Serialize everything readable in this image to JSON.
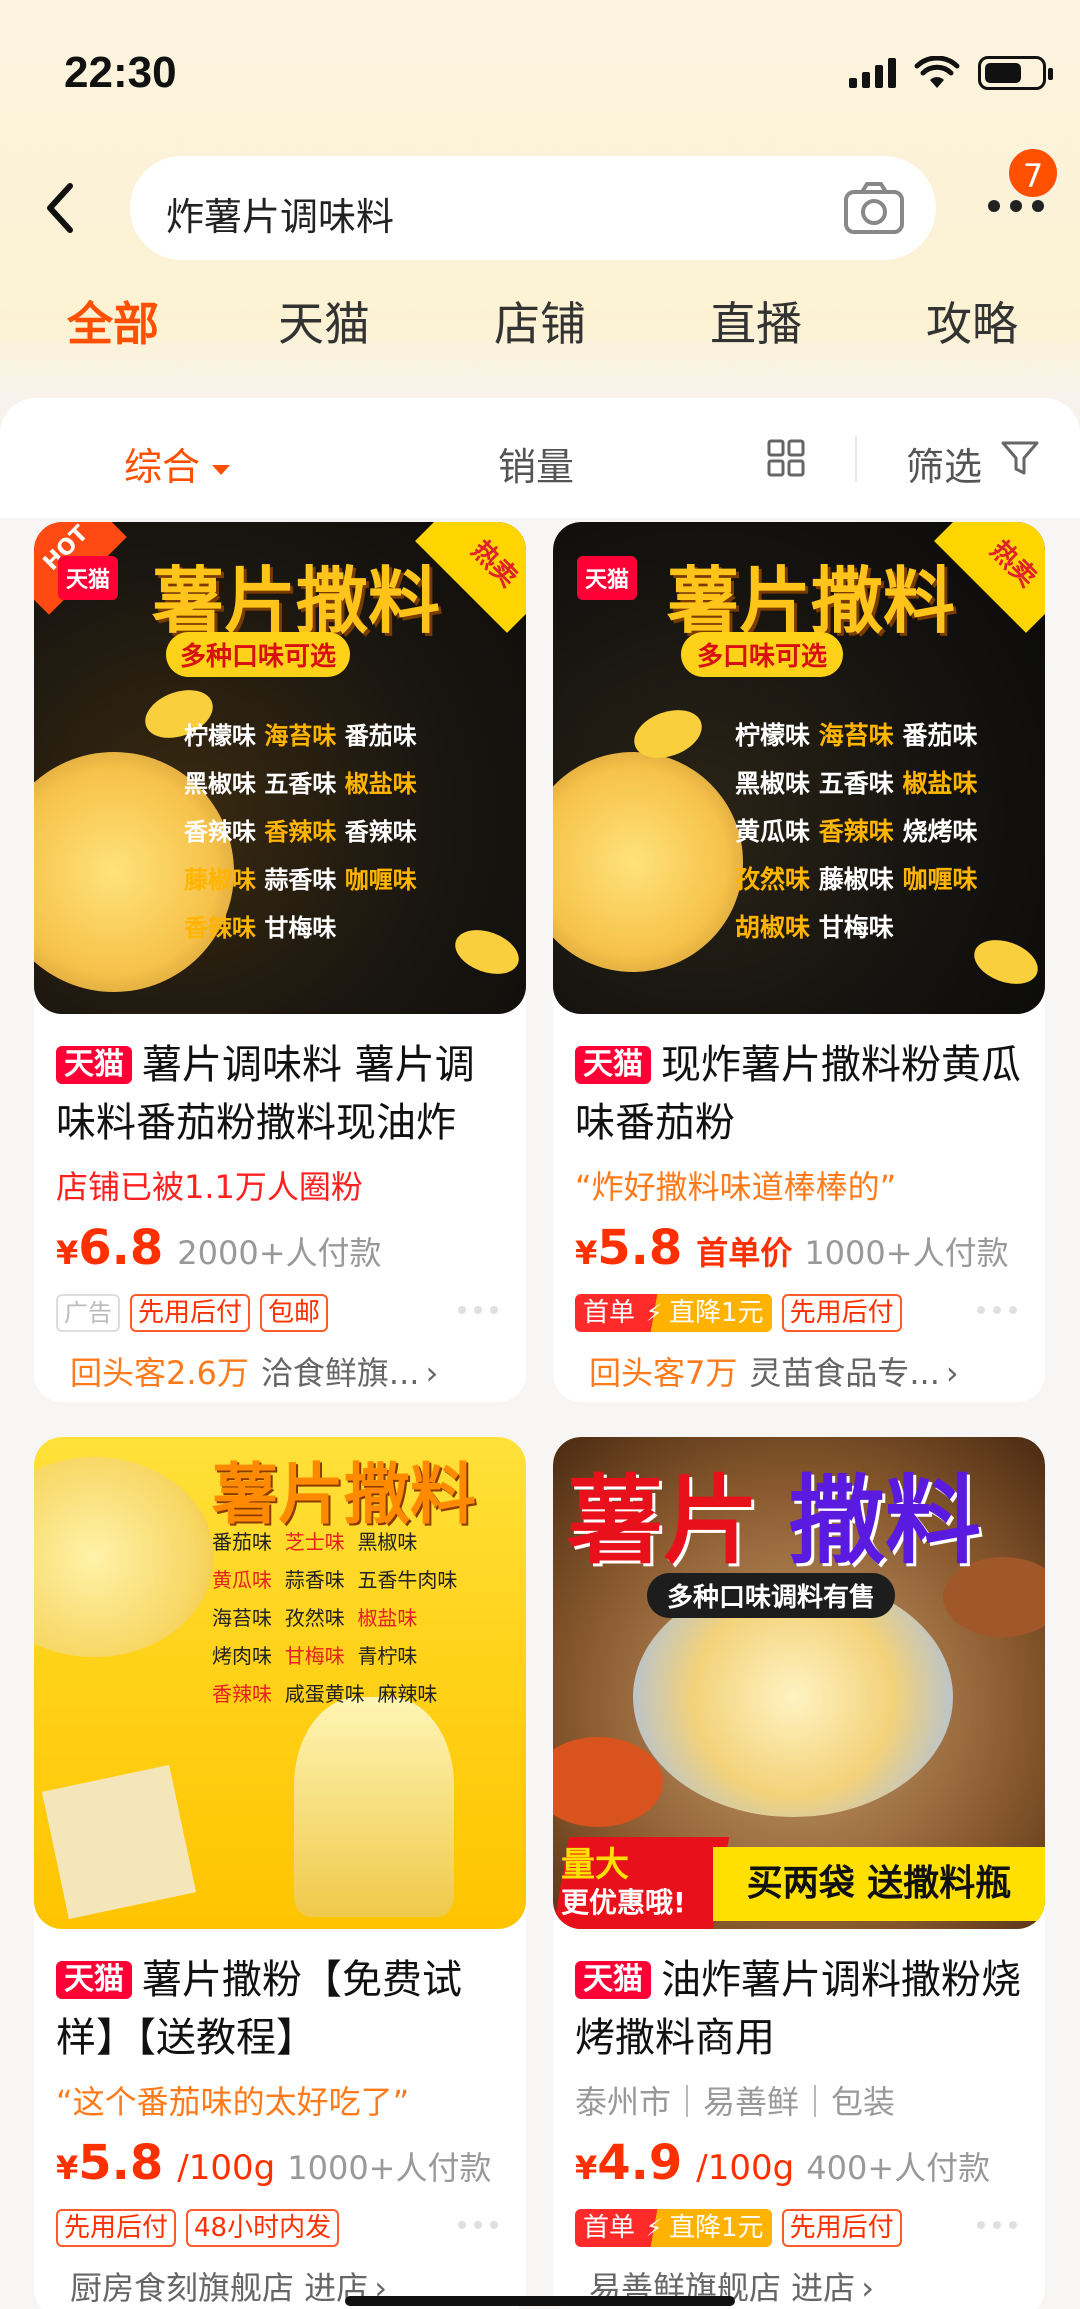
{
  "status": {
    "time": "22:30"
  },
  "search": {
    "query": "炸薯片调味料",
    "cart_badge": "7"
  },
  "tabs": [
    "全部",
    "天猫",
    "店铺",
    "直播",
    "攻略"
  ],
  "sort": {
    "comprehensive": "综合",
    "sales": "销量",
    "filter": "筛选"
  },
  "products": [
    {
      "tmall": "天猫",
      "title": "薯片调味料 薯片调味料番茄粉撒料现油炸",
      "subline": "店铺已被1.1万人圈粉",
      "yen": "¥",
      "price": "6.8",
      "paid": "2000+人付款",
      "tags": [
        "广告",
        "先用后付",
        "包邮"
      ],
      "returning": "回头客2.6万",
      "shop": "洽食鲜旗...",
      "poster": {
        "tmall": "天猫",
        "hot": "HOT",
        "hot_sale": "热卖",
        "headline": "薯片撒料",
        "badge": "多种口味可选",
        "flavors": [
          [
            "柠檬味",
            "海苔味",
            "番茄味"
          ],
          [
            "黑椒味",
            "五香味",
            "椒盐味"
          ],
          [
            "香辣味",
            "香辣味",
            "香辣味"
          ],
          [
            "藤椒味",
            "蒜香味",
            "咖喱味"
          ],
          [
            "香辣味",
            "甘梅味",
            ""
          ]
        ]
      }
    },
    {
      "tmall": "天猫",
      "title": "现炸薯片撒料粉黄瓜味番茄粉",
      "subline": "“炸好撒料味道棒棒的”",
      "yen": "¥",
      "price": "5.8",
      "first_price": "首单价",
      "paid": "1000+人付款",
      "first_tag": [
        "首单",
        "直降1元"
      ],
      "tags": [
        "先用后付"
      ],
      "returning": "回头客7万",
      "shop": "灵苗食品专...",
      "poster": {
        "tmall": "天猫",
        "hot_sale": "热卖",
        "headline": "薯片撒料",
        "badge": "多口味可选",
        "flavors": [
          [
            "柠檬味",
            "海苔味",
            "番茄味"
          ],
          [
            "黑椒味",
            "五香味",
            "椒盐味"
          ],
          [
            "黄瓜味",
            "香辣味",
            "烧烤味"
          ],
          [
            "孜然味",
            "藤椒味",
            "咖喱味"
          ],
          [
            "胡椒味",
            "甘梅味",
            ""
          ]
        ]
      }
    },
    {
      "tmall": "天猫",
      "title": "薯片撒粉【免费试样】【送教程】",
      "subline": "“这个番茄味的太好吃了”",
      "yen": "¥",
      "price": "5.8",
      "unit": "/100g",
      "paid": "1000+人付款",
      "tags": [
        "先用后付",
        "48小时内发"
      ],
      "shop": "厨房食刻旗舰店 进店",
      "poster": {
        "headline": "薯片撒料",
        "flavors": [
          [
            "番茄味",
            "芝士味",
            "黑椒味"
          ],
          [
            "黄瓜味",
            "蒜香味",
            "五香牛肉味"
          ],
          [
            "海苔味",
            "孜然味",
            "椒盐味"
          ],
          [
            "烤肉味",
            "甘梅味",
            "青柠味"
          ],
          [
            "香辣味",
            "咸蛋黄味",
            "麻辣味"
          ]
        ]
      }
    },
    {
      "tmall": "天猫",
      "title": "油炸薯片调料撒粉烧烤撒料商用",
      "subline": "泰州市｜易善鲜｜包装",
      "yen": "¥",
      "price": "4.9",
      "unit": "/100g",
      "paid": "400+人付款",
      "first_tag": [
        "首单",
        "直降1元"
      ],
      "tags": [
        "先用后付"
      ],
      "shop": "易善鲜旗舰店 进店",
      "poster": {
        "headline_a": "薯片",
        "headline_b": "撒料",
        "badge": "多种口味调料有售",
        "corner_a": "量大",
        "corner_b": "更优惠哦!",
        "promo": "买两袋 送撒料瓶"
      }
    }
  ]
}
